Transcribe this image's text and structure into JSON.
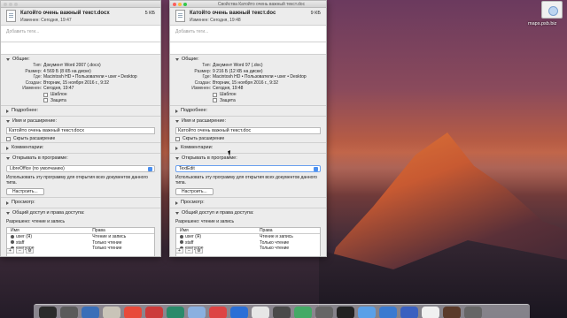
{
  "desktop": {
    "widget_label": "maps.psb.biz",
    "dock_icon_colors": [
      "#2b2b2b",
      "#5a5a5a",
      "#3a6fb8",
      "#c9c4b8",
      "#e84a3a",
      "#cc3b3b",
      "#2a8a6a",
      "#8ab0e0",
      "#d44",
      "#2b6fd6",
      "#e6e6e6",
      "#4a4a4a",
      "#4a6",
      "#666",
      "#222",
      "#5aa0e8",
      "#3a7ad0",
      "#3a60c0",
      "#f0f0f0",
      "#5a3a2a",
      "#666"
    ]
  },
  "window1": {
    "title": "",
    "filename": "Катойто очень важный текст.docx",
    "size": "5 КБ",
    "modified": "Изменен: Сегодня, 19:47",
    "tags_placeholder": "Добавить теги...",
    "general_label": "Общие:",
    "general": [
      {
        "k": "Тип:",
        "v": "Документ Word 2007 (.docx)"
      },
      {
        "k": "Размер:",
        "v": "4 569 Б (8 КБ на диске)"
      },
      {
        "k": "Где:",
        "v": "Macintosh HD • Пользователи • user • Desktop"
      },
      {
        "k": "Создан:",
        "v": "Вторник, 15 ноября 2016 г., 9:32"
      },
      {
        "k": "Изменен:",
        "v": "Сегодня, 19:47"
      }
    ],
    "template_label": "Шаблон",
    "locked_label": "Защита",
    "more_info": "Подробнее:",
    "name_ext": "Имя и расширение:",
    "name_value": "Катойто очень важный текст.docx",
    "hide_ext": "Скрыть расширение",
    "comments": "Комментарии:",
    "open_with": "Открывать в программе:",
    "app_value": "LibreOffice (по умолчанию)",
    "use_app_note": "Использовать эту программу для открытия всех документов данного типа.",
    "change_all": "Настроить...",
    "preview": "Просмотр:",
    "sharing": "Общий доступ и права доступа:",
    "privilege": "Разрешено: чтение и запись",
    "perm_headers": [
      "Имя",
      "Права"
    ],
    "perms": [
      {
        "name": "user (Я)",
        "priv": "Чтение и запись"
      },
      {
        "name": "staff",
        "priv": "Только чтение"
      },
      {
        "name": "everyone",
        "priv": "Только чтение"
      }
    ]
  },
  "window2": {
    "title": "Свойства Катойто очень важный текст.doc",
    "filename": "Катойто очень важный текст.doc",
    "size": "9 КБ",
    "modified": "Изменен: Сегодня, 19:48",
    "tags_placeholder": "Добавить теги...",
    "general_label": "Общие:",
    "general": [
      {
        "k": "Тип:",
        "v": "Документ Word 97 (.doc)"
      },
      {
        "k": "Размер:",
        "v": "9 216 Б (12 КБ на диске)"
      },
      {
        "k": "Где:",
        "v": "Macintosh HD • Пользователи • user • Desktop"
      },
      {
        "k": "Создан:",
        "v": "Вторник, 15 ноября 2016 г., 9:32"
      },
      {
        "k": "Изменен:",
        "v": "Сегодня, 19:48"
      }
    ],
    "template_label": "Шаблон",
    "locked_label": "Защита",
    "more_info": "Подробнее:",
    "name_ext": "Имя и расширение:",
    "name_value": "Катойто очень важный текст.doc",
    "hide_ext": "Скрыть расширение",
    "comments": "Комментарии:",
    "open_with": "Открывать в программе:",
    "app_value": "TextEdit",
    "use_app_note": "Использовать эту программу для открытия всех документов данного типа.",
    "change_all": "Настроить...",
    "preview": "Просмотр:",
    "sharing": "Общий доступ и права доступа:",
    "privilege": "Разрешено: чтение и запись",
    "perm_headers": [
      "Имя",
      "Права"
    ],
    "perms": [
      {
        "name": "user (Я)",
        "priv": "Чтение и запись"
      },
      {
        "name": "staff",
        "priv": "Только чтение"
      },
      {
        "name": "everyone",
        "priv": "Только чтение"
      }
    ]
  }
}
